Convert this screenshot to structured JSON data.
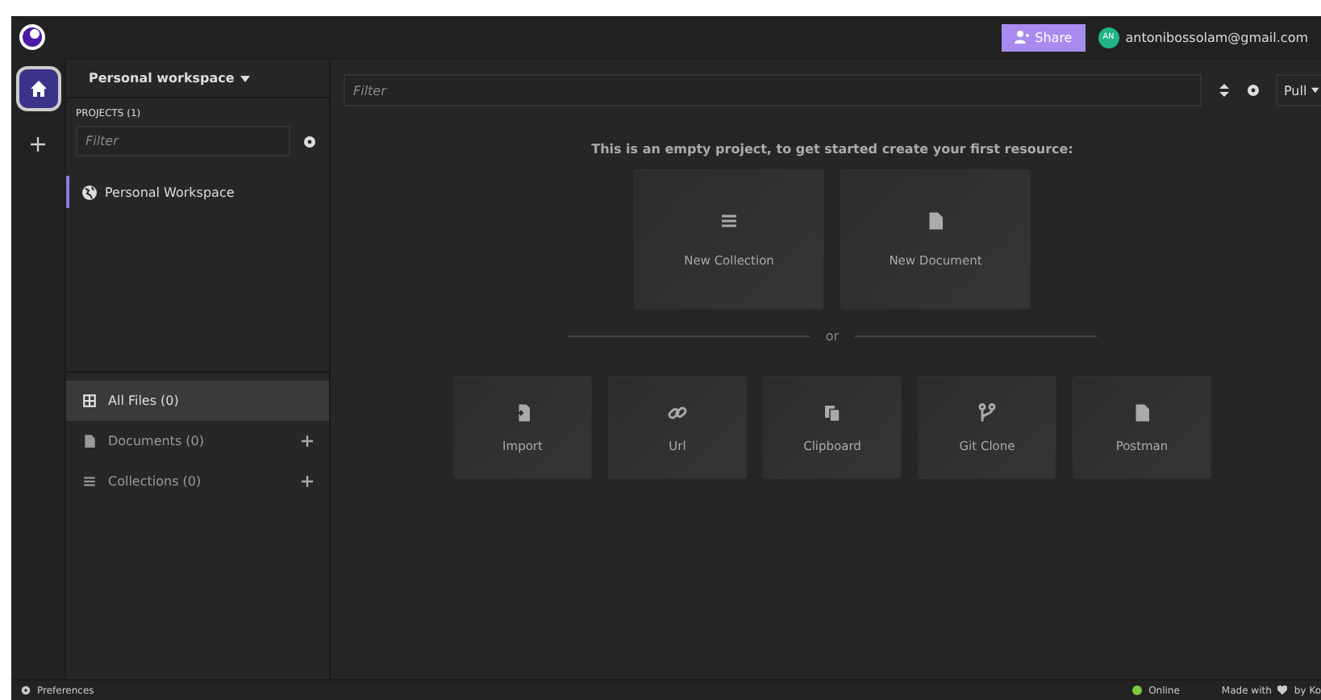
{
  "topbar": {
    "share_button": "Share",
    "avatar_initials": "AN",
    "account": "antonibossolam@gmail.com"
  },
  "rail": [
    {
      "kind": "home",
      "selected": true
    },
    {
      "kind": "add",
      "selected": false
    }
  ],
  "sidebar": {
    "workspace": "Personal workspace",
    "projects_heading": "PROJECTS (1)",
    "filter": {
      "placeholder": "Filter"
    },
    "projects": [
      {
        "label": "Personal Workspace",
        "selected": true
      }
    ],
    "sections": [
      {
        "kind": "all",
        "label": "All Files (0)",
        "selected": true,
        "addable": false
      },
      {
        "kind": "documents",
        "label": "Documents (0)",
        "selected": false,
        "addable": true
      },
      {
        "kind": "collections",
        "label": "Collections (0)",
        "selected": false,
        "addable": true
      }
    ]
  },
  "main": {
    "filter": {
      "placeholder": "Filter"
    },
    "pull_button": "Pull",
    "message": "This is an empty project, to get started create your first resource:",
    "create_cards": [
      {
        "kind": "collection",
        "label": "New Collection"
      },
      {
        "kind": "document",
        "label": "New Document"
      }
    ],
    "separator": "or",
    "import_cards": [
      {
        "kind": "import",
        "label": "Import"
      },
      {
        "kind": "url",
        "label": "Url"
      },
      {
        "kind": "clipboard",
        "label": "Clipboard"
      },
      {
        "kind": "git",
        "label": "Git Clone"
      },
      {
        "kind": "postman",
        "label": "Postman"
      }
    ]
  },
  "status_bar": {
    "preferences": "Preferences",
    "status": {
      "label": "Online",
      "color": "#7ac943"
    },
    "credit_start": "Made with",
    "credit_end": "by Ko"
  }
}
